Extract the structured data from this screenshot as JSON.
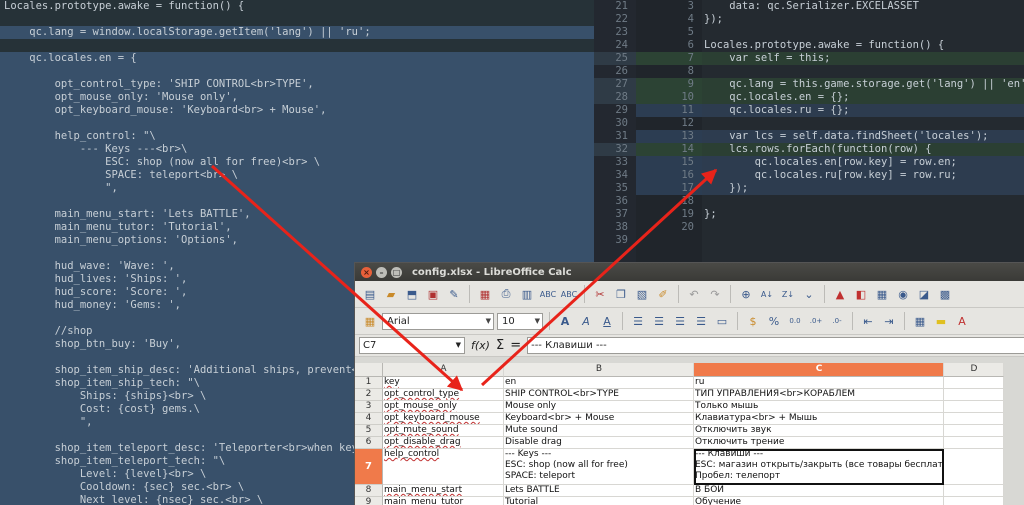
{
  "left_editor": {
    "lines": [
      {
        "t": "Locales.prototype.awake = function() {",
        "cls": ""
      },
      {
        "t": "",
        "cls": ""
      },
      {
        "t": "    qc.lang = window.localStorage.getItem('lang') || 'ru';",
        "cls": "sel"
      },
      {
        "t": "",
        "cls": ""
      },
      {
        "t": "    qc.locales.en = {",
        "cls": "sel"
      },
      {
        "t": "",
        "cls": "sel"
      },
      {
        "t": "        opt_control_type: 'SHIP CONTROL<br>TYPE',",
        "cls": "sel"
      },
      {
        "t": "        opt_mouse_only: 'Mouse only',",
        "cls": "sel"
      },
      {
        "t": "        opt_keyboard_mouse: 'Keyboard<br> + Mouse',",
        "cls": "sel"
      },
      {
        "t": "",
        "cls": "sel"
      },
      {
        "t": "        help_control: \"\\",
        "cls": "sel"
      },
      {
        "t": "            --- Keys ---<br>\\",
        "cls": "sel"
      },
      {
        "t": "                ESC: shop (now all for free)<br> \\",
        "cls": "sel"
      },
      {
        "t": "                SPACE: teleport<br> \\",
        "cls": "sel"
      },
      {
        "t": "                \",",
        "cls": "sel"
      },
      {
        "t": "",
        "cls": "sel"
      },
      {
        "t": "        main_menu_start: 'Lets BATTLE',",
        "cls": "sel"
      },
      {
        "t": "        main_menu_tutor: 'Tutorial',",
        "cls": "sel"
      },
      {
        "t": "        main_menu_options: 'Options',",
        "cls": "sel"
      },
      {
        "t": "",
        "cls": "sel"
      },
      {
        "t": "        hud_wave: 'Wave: ',",
        "cls": "sel"
      },
      {
        "t": "        hud_lives: 'Ships: ',",
        "cls": "sel"
      },
      {
        "t": "        hud_score: 'Score: ',",
        "cls": "sel"
      },
      {
        "t": "        hud_money: 'Gems: ',",
        "cls": "sel"
      },
      {
        "t": "",
        "cls": "sel"
      },
      {
        "t": "        //shop",
        "cls": "sel"
      },
      {
        "t": "        shop_btn_buy: 'Buy',",
        "cls": "sel"
      },
      {
        "t": "",
        "cls": "sel"
      },
      {
        "t": "        shop_item_ship_desc: 'Additional ships, prevent<br> e",
        "cls": "sel"
      },
      {
        "t": "        shop_item_ship_tech: \"\\",
        "cls": "sel"
      },
      {
        "t": "            Ships: {ships}<br> \\",
        "cls": "sel"
      },
      {
        "t": "            Cost: {cost} gems.\\",
        "cls": "sel"
      },
      {
        "t": "            \",",
        "cls": "sel"
      },
      {
        "t": "",
        "cls": "sel"
      },
      {
        "t": "        shop_item_teleport_desc: 'Teleporter<br>when key SPACE",
        "cls": "sel"
      },
      {
        "t": "        shop_item_teleport_tech: \"\\",
        "cls": "sel"
      },
      {
        "t": "            Level: {level}<br> \\",
        "cls": "sel"
      },
      {
        "t": "            Cooldown: {sec} sec.<br> \\",
        "cls": "sel"
      },
      {
        "t": "            Next level: {nsec} sec.<br> \\",
        "cls": "sel"
      }
    ]
  },
  "right_editor": {
    "gutter_a": [
      "21",
      "22",
      "23",
      "24",
      "25",
      "26",
      "27",
      "28",
      "29",
      "30",
      "31",
      "32",
      "33",
      "34",
      "35",
      "36",
      "37",
      "38",
      "39"
    ],
    "gutter_b": [
      "3",
      "4",
      "5",
      "6",
      "7",
      "8",
      "9",
      "10",
      "11",
      "12",
      "13",
      "14",
      "15",
      "16",
      "17",
      "18",
      "19",
      "20",
      ""
    ],
    "lines": [
      {
        "t": "    data: qc.Serializer.EXCELASSET",
        "cls": ""
      },
      {
        "t": "});",
        "cls": ""
      },
      {
        "t": "",
        "cls": ""
      },
      {
        "t": "Locales.prototype.awake = function() {",
        "cls": ""
      },
      {
        "t": "    var self = this;",
        "cls": "add"
      },
      {
        "t": "",
        "cls": ""
      },
      {
        "t": "    qc.lang = this.game.storage.get('lang') || 'en';",
        "cls": "add"
      },
      {
        "t": "    qc.locales.en = {};",
        "cls": "add"
      },
      {
        "t": "    qc.locales.ru = {};",
        "cls": "chg"
      },
      {
        "t": "",
        "cls": ""
      },
      {
        "t": "    var lcs = self.data.findSheet('locales');",
        "cls": "chg"
      },
      {
        "t": "    lcs.rows.forEach(function(row) {",
        "cls": "add"
      },
      {
        "t": "        qc.locales.en[row.key] = row.en;",
        "cls": "chg"
      },
      {
        "t": "        qc.locales.ru[row.key] = row.ru;",
        "cls": "chg"
      },
      {
        "t": "    });",
        "cls": "chg"
      },
      {
        "t": "",
        "cls": ""
      },
      {
        "t": "};",
        "cls": ""
      },
      {
        "t": "",
        "cls": ""
      },
      {
        "t": "",
        "cls": ""
      }
    ]
  },
  "calc": {
    "window_title": "config.xlsx - LibreOffice Calc",
    "font_name": "Arial",
    "font_size": "10",
    "name_box": "C7",
    "formula_text": "--- Клавиши ---",
    "columns": [
      "A",
      "B",
      "C",
      "D"
    ],
    "rows": [
      {
        "n": "1",
        "a": "key",
        "b": "en",
        "c": "ru"
      },
      {
        "n": "2",
        "a": "opt_control_type",
        "b": "SHIP CONTROL<br>TYPE",
        "c": "ТИП УПРАВЛЕНИЯ<br>КОРАБЛЕМ"
      },
      {
        "n": "3",
        "a": "opt_mouse_only",
        "b": "Mouse only",
        "c": "Только мышь"
      },
      {
        "n": "4",
        "a": "opt_keyboard_mouse",
        "b": "Keyboard<br> + Mouse",
        "c": "Клавиатура<br> + Мышь"
      },
      {
        "n": "5",
        "a": "opt_mute_sound",
        "b": "Mute sound",
        "c": "Отключить звук"
      },
      {
        "n": "6",
        "a": "opt_disable_drag",
        "b": "Disable drag",
        "c": "Отключить трение"
      },
      {
        "n": "7",
        "a": "help_control",
        "b_lines": [
          "--- Keys ---",
          "ESC: shop (now all for free)",
          "SPACE: teleport"
        ],
        "c_lines": [
          "--- Клавиши ---",
          "ESC: магазин открыть/закрыть (все товары бесплатно)",
          "Пробел: телепорт"
        ]
      },
      {
        "n": "8",
        "a": "main_menu_start",
        "b": "Lets BATTLE",
        "c": "В БОЙ"
      },
      {
        "n": "9",
        "a": "main_menu_tutor",
        "b": "Tutorial",
        "c": "Обучение"
      }
    ]
  },
  "colors": {
    "arrow": "#e8231a",
    "active_header": "#f07a4a"
  }
}
